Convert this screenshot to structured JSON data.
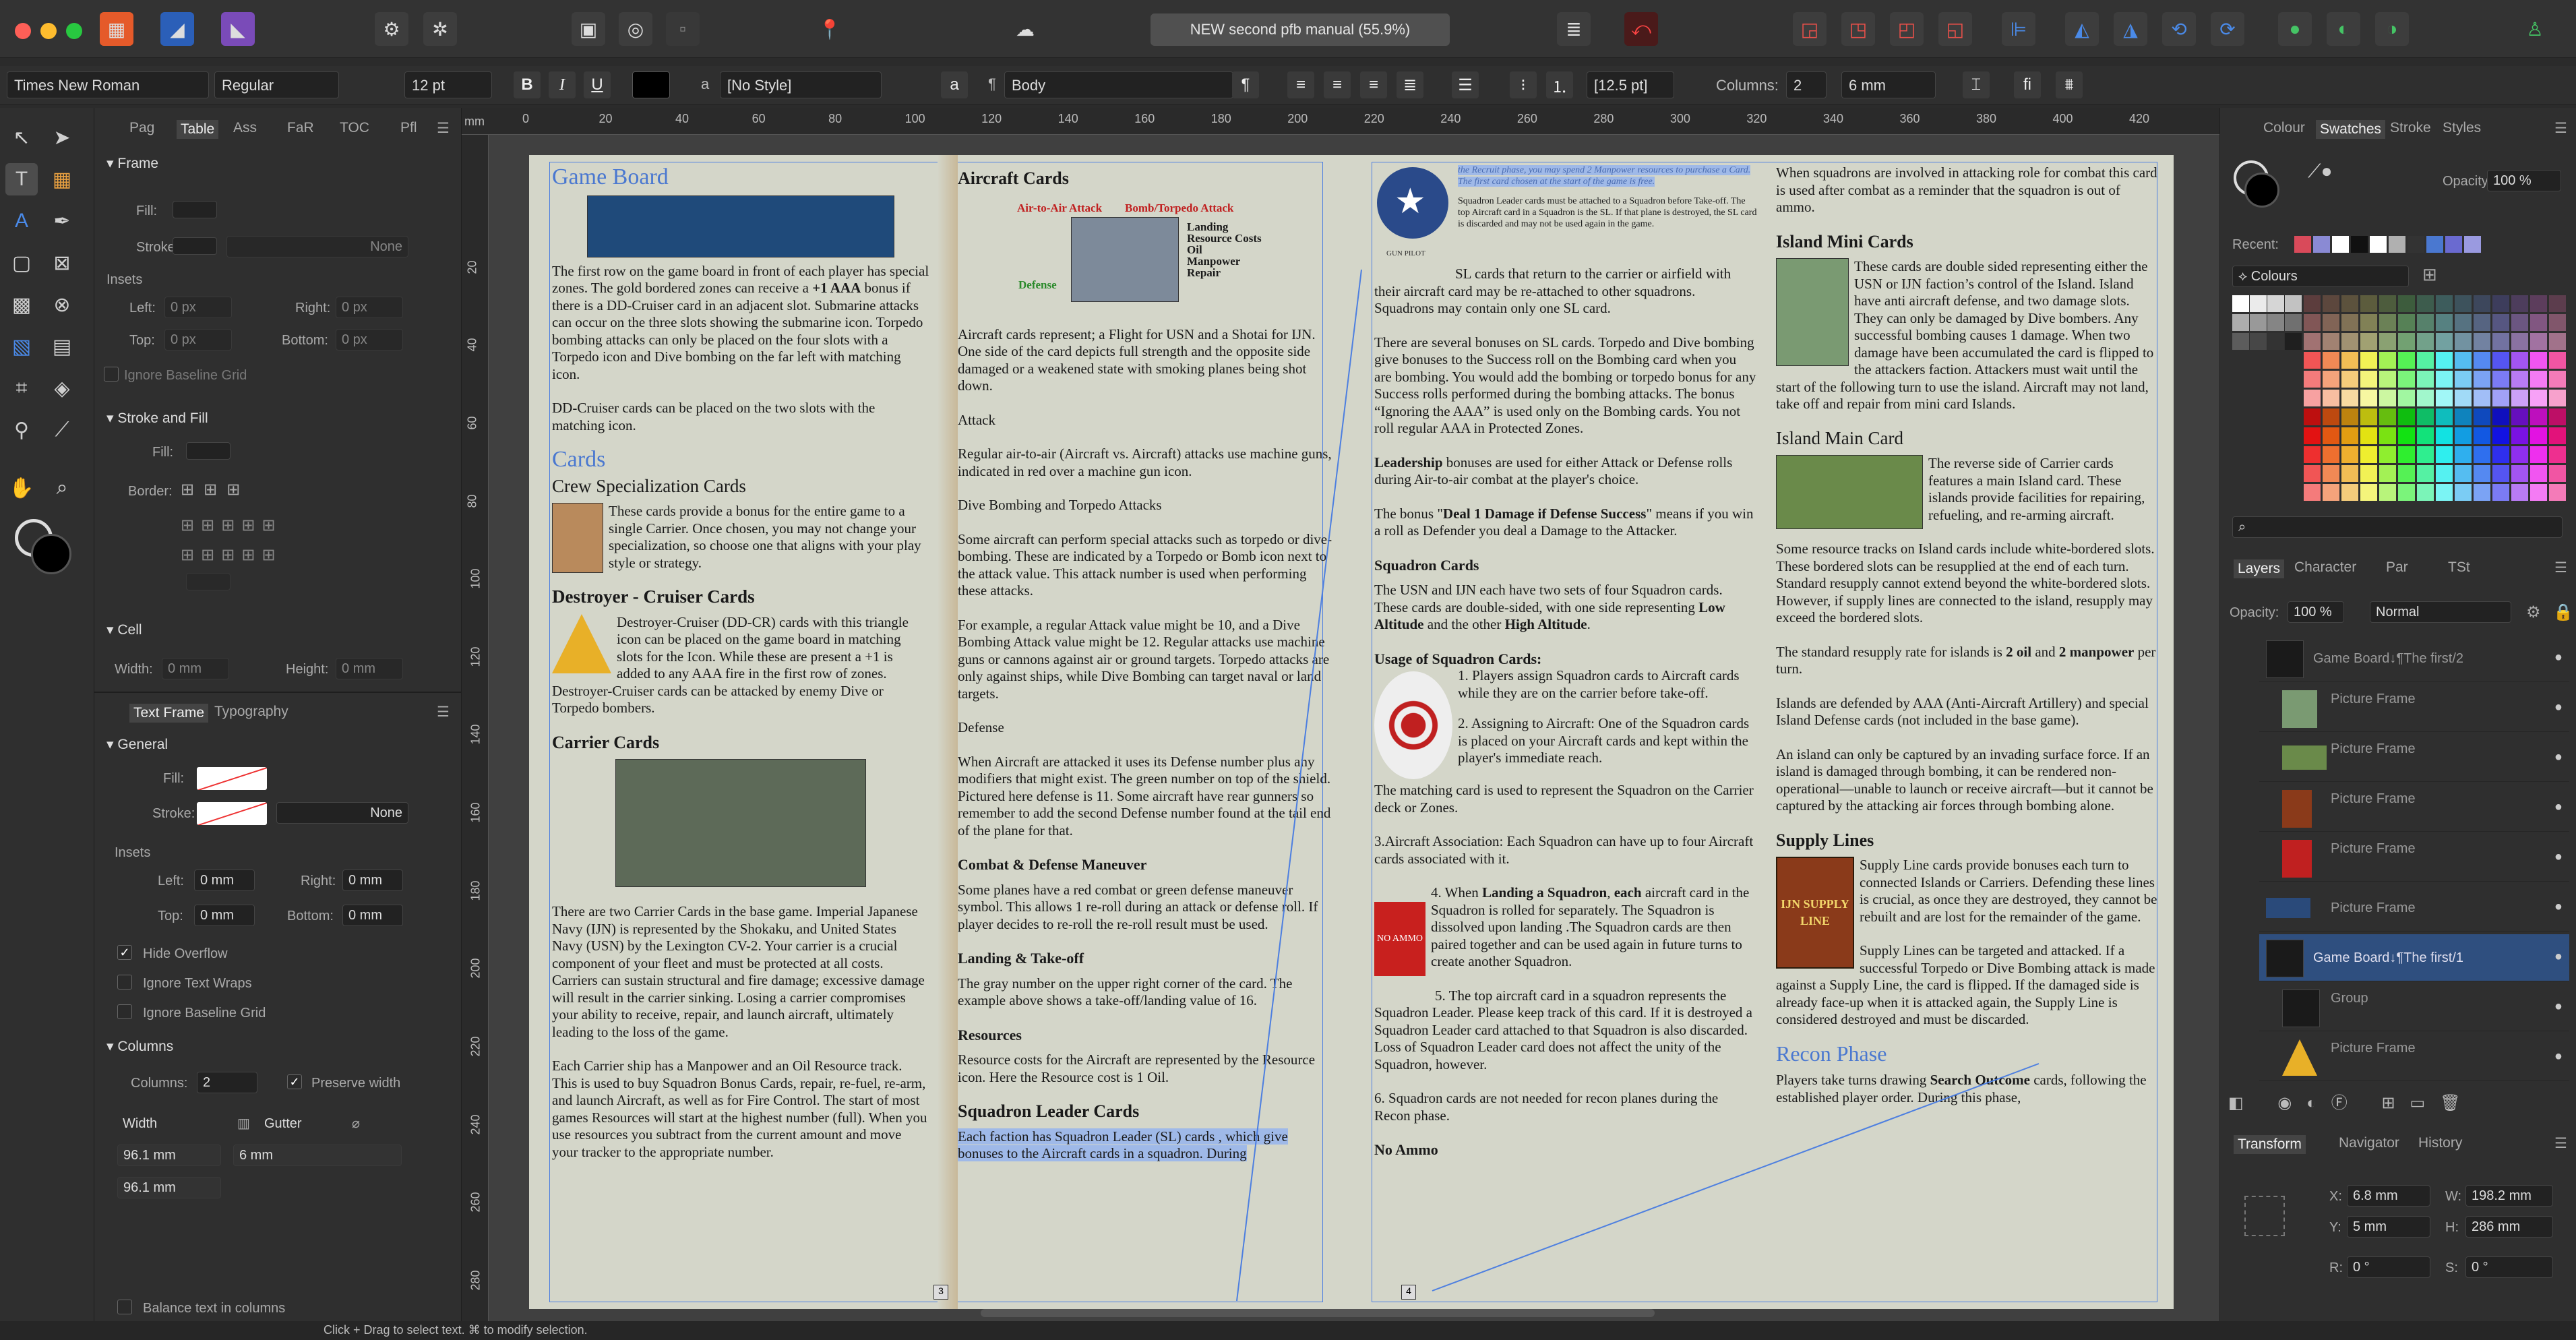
{
  "window": {
    "title": "NEW second pfb manual (55.9%)"
  },
  "context": {
    "font": "Times New Roman",
    "style": "Regular",
    "size": "12 pt",
    "bold": "B",
    "italic": "I",
    "underline": "U",
    "char_style": "[No Style]",
    "a_glyph": "a",
    "para_glyph": "¶",
    "para_style": "Body",
    "pilcrow": "¶",
    "leading": "[12.5 pt]",
    "columns_label": "Columns:",
    "columns": "2",
    "gutter": "6 mm",
    "fi": "fi"
  },
  "left_panel": {
    "tabs": [
      "Pag",
      "Table",
      "Ass",
      "FaR",
      "TOC",
      "Pfl"
    ],
    "frame_section": "Frame",
    "fill": "Fill:",
    "stroke": "Stroke:",
    "none": "None",
    "insets": "Insets",
    "left": "Left:",
    "right": "Right:",
    "top": "Top:",
    "bottom": "Bottom:",
    "zero_px": "0 px",
    "ignore_baseline": "Ignore Baseline Grid",
    "stroke_fill": "Stroke and Fill",
    "border": "Border:",
    "cell": "Cell",
    "width": "Width:",
    "height": "Height:",
    "zero_mm": "0 mm",
    "tf_tabs": [
      "Text Frame",
      "Typography"
    ],
    "general": "General",
    "hide_overflow": "Hide Overflow",
    "ignore_wraps": "Ignore Text Wraps",
    "columns_sec": "Columns",
    "columns_lbl": "Columns:",
    "columns_val": "2",
    "preserve": "Preserve width",
    "width_hdr": "Width",
    "gutter_hdr": "Gutter",
    "w1": "96.1 mm",
    "g1": "6 mm",
    "w2": "96.1 mm",
    "balance": "Balance text in columns"
  },
  "ruler": [
    "0",
    "20",
    "40",
    "60",
    "80",
    "100",
    "120",
    "140",
    "160",
    "180",
    "200",
    "220",
    "240",
    "260",
    "280",
    "300",
    "320",
    "340",
    "360",
    "380",
    "400",
    "420"
  ],
  "ruler_unit": "mm",
  "vruler": [
    "20",
    "40",
    "60",
    "80",
    "100",
    "120",
    "140",
    "160",
    "180",
    "200",
    "220",
    "240",
    "260",
    "280"
  ],
  "page1": {
    "col1": {
      "h_game": "Game Board",
      "p1a": "The first row on the game board in front of each player has special zones. The gold bordered zones can receive a ",
      "p1b": "+1 AAA",
      "p1c": " bonus if there is a DD-Cruiser card in an adjacent slot. Submarine attacks can occur on the three slots showing the submarine icon. Torpedo bombing attacks can only be placed on the four slots with a Torpedo icon and Dive bombing on the far left with matching icon.",
      "p2": "DD-Cruiser cards can be placed on the two slots with the matching icon.",
      "h_cards": "Cards",
      "h_crew": "Crew Specialization Cards",
      "p3": "These cards provide a bonus for the entire game to a single Carrier. Once chosen, you may not change your specialization, so choose one that aligns with your play style or strategy.",
      "h_dd": "Destroyer - Cruiser Cards",
      "p4": "Destroyer-Cruiser (DD-CR) cards with this triangle icon can be placed on the game board in matching slots for the Icon. While these are present a +1 is added to any AAA fire in the first row of zones. Destroyer-Cruiser cards can be attacked by enemy Dive or Torpedo bombers.",
      "h_carrier": "Carrier Cards",
      "p5": "There are two Carrier Cards in the base game. Imperial Japanese Navy (IJN) is represented by the Shokaku, and United States Navy (USN) by the Lexington CV-2. Your carrier is a crucial component of your fleet and must be protected at all costs. Carriers can sustain structural and fire damage; excessive damage will result in the carrier sinking. Losing a carrier compromises your ability to receive, repair, and launch aircraft, ultimately leading to the loss of the game.",
      "p6": "Each Carrier ship has a Manpower and an Oil Resource track. This is used to buy Squadron Bonus Cards, repair, re-fuel, re-arm, and launch Aircraft, as well as for Fire Control. The start of most games Resources will start at the highest number (full). When you use resources you subtract from the current amount and move your tracker to the appropriate number."
    },
    "col2": {
      "h_aircraft": "Aircraft Cards",
      "lbl_a2a": "Air-to-Air Attack",
      "lbl_bomb": "Bomb/Torpedo Attack",
      "lbl_land": "Landing",
      "lbl_res": "Resource Costs",
      "lbl_oil": "Oil",
      "lbl_man": "Manpower",
      "lbl_rep": "Repair",
      "lbl_def": "Defense",
      "p1": "Aircraft cards represent; a Flight for USN and a Shotai for IJN. One side of the card depicts full strength and the opposite side damaged or a weakened state with smoking planes being shot down.",
      "p_attack": "Attack",
      "p2": "Regular air-to-air (Aircraft vs. Aircraft) attacks use machine guns, indicated in red over a machine gun icon.",
      "p_dive": "Dive Bombing and Torpedo Attacks",
      "p3": "Some aircraft can perform special attacks such as torpedo or dive-bombing. These are indicated by a Torpedo or Bomb icon next to the attack value. This attack number is used when performing these attacks.",
      "p4": "For example, a regular Attack value might be 10, and a Dive Bombing Attack value might be 12. Regular attacks use machine guns or cannons against air or ground targets. Torpedo attacks are only against ships, while Dive Bombing can target naval or land targets.",
      "p_def": "Defense",
      "p5": "When Aircraft are attacked it uses its Defense number plus any modifiers that might exist. The green number on top of the shield. Pictured here defense is 11. Some aircraft have rear gunners so remember to add the second Defense number found at the tail end of the plane for that.",
      "h_combat": "Combat & Defense Maneuver",
      "p6": "Some planes have a red combat or green defense maneuver symbol. This allows 1 re-roll during an attack or defense roll. If player decides to re-roll the re-roll result must be used.",
      "h_land": "Landing & Take-off",
      "p7": "The gray number on the upper right corner of the card. The example above shows a take-off/landing value of 16.",
      "h_res": "Resources",
      "p8": "Resource costs for the Aircraft are represented by the Resource icon. Here the Resource cost is 1 Oil.",
      "h_sl": "Squadron Leader Cards",
      "p9": "Each faction has Squadron Leader (SL) cards , which give bonuses to the Aircraft cards in a squadron. During"
    }
  },
  "page2": {
    "col3": {
      "p0": "the Recruit phase, you may spend 2 Manpower resources to purchase a Card. The first card chosen at the start of the game is free.",
      "p0b": "Squadron Leader cards must be attached to a Squadron before Take-off. The top Aircraft card in a Squadron is the SL. If that plane is destroyed, the SL card is discarded and may not be used again in the game.",
      "p1": "SL cards that return to the carrier or airfield with their aircraft card may be re-attached to other squadrons. Squadrons may contain only one SL card.",
      "p2": "There are several bonuses on SL cards. Torpedo and Dive bombing give bonuses to the Success roll on the Bombing card when you are bombing. You would add the bombing or torpedo bonus for any Success rolls performed during the bombing attacks. The bonus “Ignoring the AAA” is used only on the Bombing cards. You not roll regular AAA in Protected Zones.",
      "p3a": "Leadership",
      "p3b": " bonuses are used for either Attack or Defense rolls during Air-to-air combat at the player's choice.",
      "p4a": "The bonus \"",
      "p4b": "Deal 1 Damage if Defense Success",
      "p4c": "\" means if you win a roll as Defender you deal a Damage to the Attacker.",
      "h_sq": "Squadron Cards",
      "p5a": "The USN and IJN each have two sets of four Squadron cards. These cards are double-sided, with one side representing ",
      "p5b": "Low Altitude",
      "p5c": " and the other ",
      "p5d": "High Altitude",
      "p5e": ".",
      "h_usage": "Usage of Squadron Cards:",
      "l1": "1.  Players assign Squadron cards to Aircraft cards while they are on the carrier before take-off.",
      "l2": "2. Assigning to Aircraft: One of  the Squadron cards is placed on your Aircraft cards and kept within the player's immediate reach.",
      "p6": "The matching card is used to represent the Squadron on the Carrier deck or Zones.",
      "p7": "3.Aircraft Association: Each Squadron can have up to four Aircraft cards associated with it.",
      "p8a": "4. When ",
      "p8b": "Landing a Squadron",
      "p8c": ", ",
      "p8d": "each",
      "p8e": " aircraft card in the Squadron is rolled for separately. The Squadron is dissolved upon landing .The Squadron cards are then paired together and can be used again in future turns to create another Squadron.",
      "p9": "5. The top aircraft card in a squadron represents the Squadron Leader. Please keep track of this card. If it is destroyed a Squadron Leader card attached to that Squadron is also discarded. Loss of Squadron Leader card does not affect the unity of the Squadron, however.",
      "p10": "6. Squadron cards are not needed for recon planes during the Recon phase.",
      "h_noammo": "No Ammo",
      "img_noammo": "NO AMMO",
      "img_gunpilot": "GUN PILOT"
    },
    "col4": {
      "p0": "When squadrons are involved in attacking role for combat this card is used after combat as a reminder that the squadron is out of ammo.",
      "h_mini": "Island Mini Cards",
      "p1": "These cards are double sided representing either the USN or IJN faction’s control of the Island. Island have anti aircraft defense, and two damage slots. They can only be damaged by Dive bombers. Any successful bombing causes 1 damage. When two damage have been accumulated the card is flipped to the attackers faction. Attackers must wait until the start of the following turn to use the island. Aircraft may not land, take off and repair from mini card Islands.",
      "h_main": "Island Main Card",
      "p2": "The reverse side of Carrier cards features a main Island card. These islands provide facilities for repairing, refueling, and re-arming aircraft.",
      "p3": "Some resource tracks on Island cards include white-bordered slots. These bordered slots can be resupplied at the end of each turn. Standard resupply cannot extend beyond the white-bordered slots. However, if supply lines are connected to the island, resupply may exceed the bordered slots.",
      "p4a": "The standard resupply rate for islands is ",
      "p4b": "2 oil",
      "p4c": " and ",
      "p4d": "2 manpower",
      "p4e": " per turn.",
      "p5": "Islands are defended by AAA (Anti-Aircraft Artillery) and special Island Defense cards (not included in the base game).",
      "p6": "An island can only be captured by an invading surface force. If an island is damaged through bombing, it can be rendered non-operational—unable to launch or receive aircraft—but it cannot be captured by the attacking air forces through bombing alone.",
      "h_supply": "Supply Lines",
      "p7": "Supply Line cards provide bonuses each turn to connected Islands or Carriers. Defending these lines is crucial, as once they are destroyed, they cannot be rebuilt and are lost for the remainder of the game.",
      "p8": "Supply Lines can be targeted and attacked. If a successful Torpedo or Dive Bombing attack is made against a Supply Line, the card is flipped. If the damaged side is already face-up when it is attacked again, the Supply Line is considered destroyed and must be discarded.",
      "h_recon": "Recon Phase",
      "p9a": "Players take turns drawing ",
      "p9b": "Search Outcome",
      "p9c": " cards, following the established player order. During this phase,",
      "img_supply": "IJN SUPPLY LINE"
    }
  },
  "right_panel": {
    "tabs": [
      "Colour",
      "Swatches",
      "Stroke",
      "Styles"
    ],
    "opacity_lbl": "Opacity:",
    "opacity": "100 %",
    "recent": "Recent:",
    "palette": "Colours",
    "layer_tabs": [
      "Layers",
      "Character",
      "Par",
      "TSt"
    ],
    "blend": "Normal",
    "layers": [
      "Game Board↓¶The first/2",
      "Picture Frame",
      "Picture Frame",
      "Picture Frame",
      "Picture Frame",
      "Picture Frame",
      "Game Board↓¶The first/1",
      "Group",
      "Picture Frame"
    ],
    "transform_tabs": [
      "Transform",
      "Navigator",
      "History"
    ],
    "x_lbl": "X:",
    "x": "6.8 mm",
    "y_lbl": "Y:",
    "y": "5 mm",
    "w_lbl": "W:",
    "w": "198.2 mm",
    "h_lbl": "H:",
    "h": "286 mm",
    "r_lbl": "R:",
    "r": "0 °",
    "s_lbl": "S:",
    "s": "0 °"
  },
  "status": {
    "text": "Click + Drag to select text. ⌘ to modify selection."
  },
  "colors": {
    "accent": "#4a78d0",
    "selection": "#2f4f7f",
    "heading_blue": "#4a78d0",
    "red": "#d9402e"
  }
}
